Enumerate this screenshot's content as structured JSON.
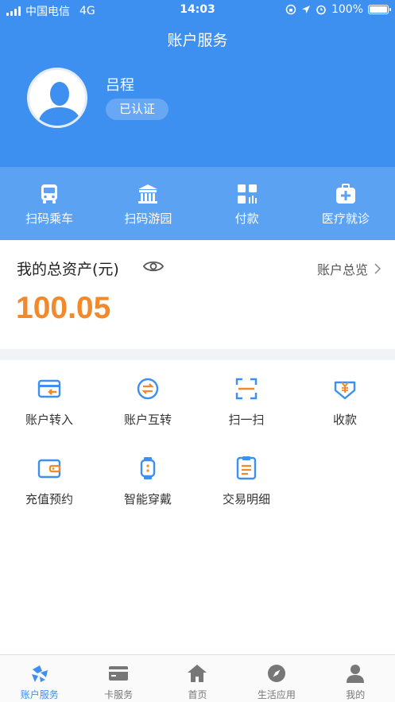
{
  "status_bar": {
    "carrier": "中国电信",
    "network": "4G",
    "time": "14:03",
    "battery": "100%"
  },
  "header": {
    "title": "账户服务",
    "user_name": "吕程",
    "verified_label": "已认证"
  },
  "quick_actions": [
    {
      "label": "扫码乘车",
      "icon": "bus-icon"
    },
    {
      "label": "扫码游园",
      "icon": "park-gate-icon"
    },
    {
      "label": "付款",
      "icon": "payment-code-icon"
    },
    {
      "label": "医疗就诊",
      "icon": "medical-kit-icon"
    }
  ],
  "assets": {
    "title": "我的总资产(元)",
    "overview_label": "账户总览",
    "total": "100.05"
  },
  "services": [
    {
      "label": "账户转入",
      "icon": "card-in-icon"
    },
    {
      "label": "账户互转",
      "icon": "transfer-icon"
    },
    {
      "label": "扫一扫",
      "icon": "scan-icon"
    },
    {
      "label": "收款",
      "icon": "receive-money-icon"
    },
    {
      "label": "充值预约",
      "icon": "wallet-icon"
    },
    {
      "label": "智能穿戴",
      "icon": "smartwatch-icon"
    },
    {
      "label": "交易明细",
      "icon": "transaction-list-icon"
    }
  ],
  "tabs": [
    {
      "label": "账户服务",
      "icon": "account-service-icon",
      "active": true
    },
    {
      "label": "卡服务",
      "icon": "card-icon",
      "active": false
    },
    {
      "label": "首页",
      "icon": "home-icon",
      "active": false
    },
    {
      "label": "生活应用",
      "icon": "compass-icon",
      "active": false
    },
    {
      "label": "我的",
      "icon": "profile-icon",
      "active": false
    }
  ],
  "colors": {
    "primary_blue": "#3d8ff0",
    "quick_bar_blue": "#5ba2f3",
    "amount_orange": "#f08a2c"
  }
}
